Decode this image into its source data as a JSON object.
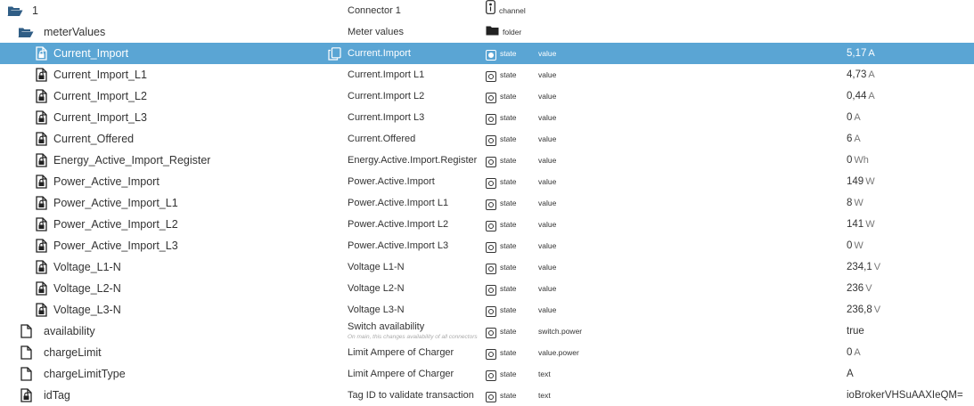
{
  "icons": {
    "folder_open": "folder-open-icon",
    "folder_closed": "folder-icon",
    "file": "file-icon",
    "locked_file": "locked-file-icon",
    "copy": "copy-icon",
    "state": "state-icon",
    "channel": "channel-icon"
  },
  "colors": {
    "selected_row": "#5aa5d4",
    "text": "#333333",
    "unit": "#777777"
  },
  "rows": [
    {
      "name": "1",
      "icon": "folder-open",
      "depth": 0,
      "desc": "Connector 1",
      "type": "channel",
      "role": "",
      "value": "",
      "unit": ""
    },
    {
      "name": "meterValues",
      "icon": "folder-open",
      "depth": 1,
      "desc": "Meter values",
      "type": "folder",
      "role": "",
      "value": "",
      "unit": ""
    },
    {
      "name": "Current_Import",
      "icon": "locked-file",
      "depth": 2,
      "desc": "Current.Import",
      "type": "state",
      "role": "value",
      "value": "5,17",
      "unit": "A",
      "selected": true
    },
    {
      "name": "Current_Import_L1",
      "icon": "locked-file",
      "depth": 2,
      "desc": "Current.Import L1",
      "type": "state",
      "role": "value",
      "value": "4,73",
      "unit": "A"
    },
    {
      "name": "Current_Import_L2",
      "icon": "locked-file",
      "depth": 2,
      "desc": "Current.Import L2",
      "type": "state",
      "role": "value",
      "value": "0,44",
      "unit": "A"
    },
    {
      "name": "Current_Import_L3",
      "icon": "locked-file",
      "depth": 2,
      "desc": "Current.Import L3",
      "type": "state",
      "role": "value",
      "value": "0",
      "unit": "A"
    },
    {
      "name": "Current_Offered",
      "icon": "locked-file",
      "depth": 2,
      "desc": "Current.Offered",
      "type": "state",
      "role": "value",
      "value": "6",
      "unit": "A"
    },
    {
      "name": "Energy_Active_Import_Register",
      "icon": "locked-file",
      "depth": 2,
      "desc": "Energy.Active.Import.Register",
      "type": "state",
      "role": "value",
      "value": "0",
      "unit": "Wh"
    },
    {
      "name": "Power_Active_Import",
      "icon": "locked-file",
      "depth": 2,
      "desc": "Power.Active.Import",
      "type": "state",
      "role": "value",
      "value": "149",
      "unit": "W"
    },
    {
      "name": "Power_Active_Import_L1",
      "icon": "locked-file",
      "depth": 2,
      "desc": "Power.Active.Import L1",
      "type": "state",
      "role": "value",
      "value": "8",
      "unit": "W"
    },
    {
      "name": "Power_Active_Import_L2",
      "icon": "locked-file",
      "depth": 2,
      "desc": "Power.Active.Import L2",
      "type": "state",
      "role": "value",
      "value": "141",
      "unit": "W"
    },
    {
      "name": "Power_Active_Import_L3",
      "icon": "locked-file",
      "depth": 2,
      "desc": "Power.Active.Import L3",
      "type": "state",
      "role": "value",
      "value": "0",
      "unit": "W"
    },
    {
      "name": "Voltage_L1-N",
      "icon": "locked-file",
      "depth": 2,
      "desc": "Voltage L1-N",
      "type": "state",
      "role": "value",
      "value": "234,1",
      "unit": "V"
    },
    {
      "name": "Voltage_L2-N",
      "icon": "locked-file",
      "depth": 2,
      "desc": "Voltage L2-N",
      "type": "state",
      "role": "value",
      "value": "236",
      "unit": "V"
    },
    {
      "name": "Voltage_L3-N",
      "icon": "locked-file",
      "depth": 2,
      "desc": "Voltage L3-N",
      "type": "state",
      "role": "value",
      "value": "236,8",
      "unit": "V"
    },
    {
      "name": "availability",
      "icon": "file",
      "depth": 1,
      "desc": "Switch availability",
      "desc2": "On main, this changes availability of all connectors",
      "type": "state",
      "role": "switch.power",
      "value": "true",
      "unit": ""
    },
    {
      "name": "chargeLimit",
      "icon": "file",
      "depth": 1,
      "desc": "Limit Ampere of Charger",
      "type": "state",
      "role": "value.power",
      "value": "0",
      "unit": "A"
    },
    {
      "name": "chargeLimitType",
      "icon": "file",
      "depth": 1,
      "desc": "Limit Ampere of Charger",
      "type": "state",
      "role": "text",
      "value": "A",
      "unit": ""
    },
    {
      "name": "idTag",
      "icon": "locked-file",
      "depth": 1,
      "desc": "Tag ID to validate transaction",
      "type": "state",
      "role": "text",
      "value": "ioBrokerVHSuAAXIeQM=",
      "unit": ""
    }
  ]
}
